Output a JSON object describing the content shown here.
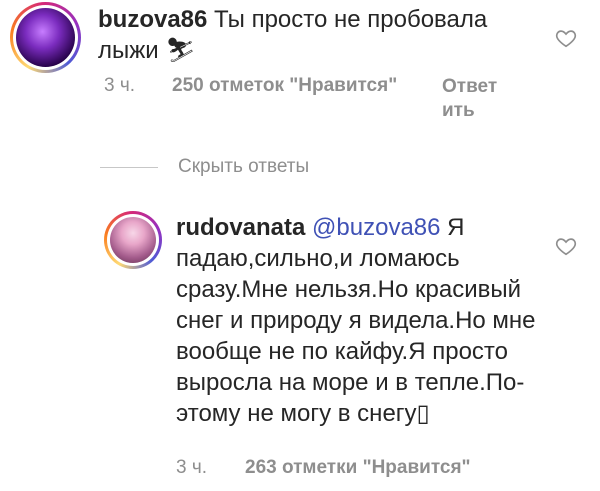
{
  "comment1": {
    "username": "buzova86",
    "text": " Ты просто не пробовала лыжи ",
    "emoji": "⛷",
    "time": "3 ч.",
    "likes": "250 отметок \"Нравится\"",
    "reply_label": "Ответ ить"
  },
  "hide_replies_label": "Скрыть ответы",
  "comment2": {
    "username": "rudovanata",
    "mention": "@buzova86",
    "text": " Я падаю,сильно,и ломаюсь сразу.Мне нельзя.Но красивый снег и природу я видела.Но мне вообще не по кайфу.Я просто выросла на море и в тепле.По-этому не могу в снегу",
    "trailing_glyph": "▯",
    "time": "3 ч.",
    "likes": "263 отметки \"Нравится\""
  },
  "icons": {
    "avatar1": "profile-avatar",
    "avatar2": "profile-avatar",
    "like": "heart-outline-icon"
  },
  "colors": {
    "text": "#262626",
    "secondary": "#8e8e8e",
    "mention": "#3f51b5"
  }
}
